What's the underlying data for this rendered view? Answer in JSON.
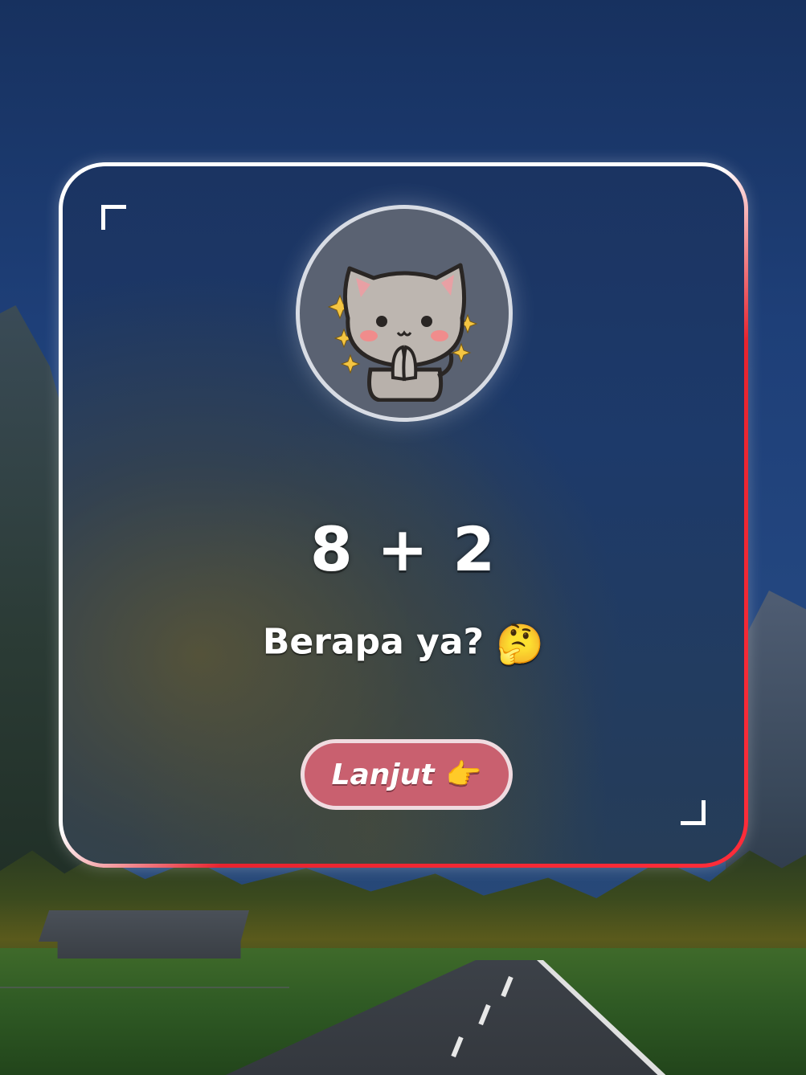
{
  "quiz": {
    "question": "8 + 2",
    "prompt": "Berapa ya?",
    "prompt_emoji": "🤔",
    "next_label": "Lanjut",
    "next_icon": "👉"
  },
  "avatar": {
    "icon": "cute-cat-praying-icon"
  },
  "colors": {
    "card_border_white": "#ffffff",
    "card_border_red": "#e7242f",
    "button_fill": "#c9606f",
    "button_border": "#f0dbe0"
  }
}
